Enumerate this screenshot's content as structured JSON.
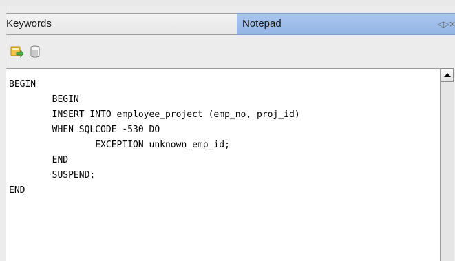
{
  "tabs": {
    "keywords_label": "Keywords",
    "notepad_label": "Notepad",
    "controls": "◁▷×"
  },
  "toolbar": {
    "buttons": [
      {
        "icon": "import-into-editor-icon"
      },
      {
        "icon": "clear-trash-icon"
      }
    ]
  },
  "editor": {
    "lines": [
      "BEGIN",
      "        BEGIN",
      "        INSERT INTO employee_project (emp_no, proj_id)",
      "        WHEN SQLCODE -530 DO",
      "                EXCEPTION unknown_emp_id;",
      "        END",
      "        SUSPEND;",
      "END"
    ]
  },
  "colors": {
    "active_tab": "#9db9e8",
    "editor_bg": "#ffffff",
    "panel_bg": "#ececec"
  }
}
